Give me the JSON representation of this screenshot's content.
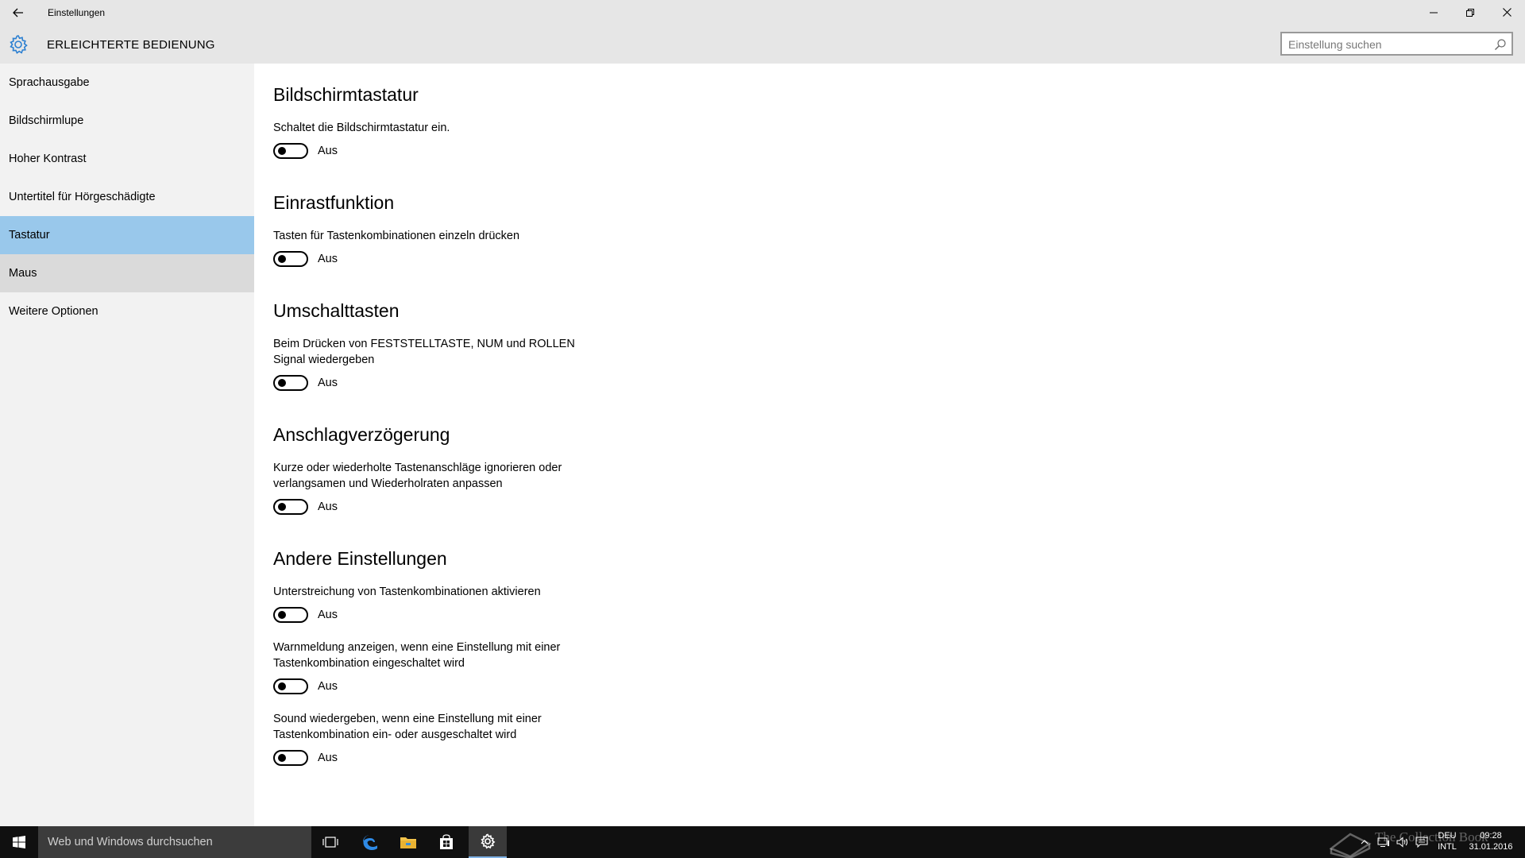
{
  "window": {
    "title": "Einstellungen",
    "header_title": "ERLEICHTERTE BEDIENUNG",
    "search_placeholder": "Einstellung suchen"
  },
  "sidebar": {
    "items": [
      {
        "label": "Sprachausgabe"
      },
      {
        "label": "Bildschirmlupe"
      },
      {
        "label": "Hoher Kontrast"
      },
      {
        "label": "Untertitel für Hörgeschädigte"
      },
      {
        "label": "Tastatur",
        "state": "selected"
      },
      {
        "label": "Maus",
        "state": "hover"
      },
      {
        "label": "Weitere Optionen"
      }
    ]
  },
  "sections": {
    "bildschirmtastatur": {
      "title": "Bildschirmtastatur",
      "items": [
        {
          "desc": "Schaltet die Bildschirmtastatur ein.",
          "state": "Aus"
        }
      ]
    },
    "einrastfunktion": {
      "title": "Einrastfunktion",
      "items": [
        {
          "desc": "Tasten für Tastenkombinationen einzeln drücken",
          "state": "Aus"
        }
      ]
    },
    "umschalttasten": {
      "title": "Umschalttasten",
      "items": [
        {
          "desc": "Beim Drücken von FESTSTELLTASTE, NUM und ROLLEN Signal wiedergeben",
          "state": "Aus"
        }
      ]
    },
    "anschlagverzoegerung": {
      "title": "Anschlagverzögerung",
      "items": [
        {
          "desc": "Kurze oder wiederholte Tastenanschläge ignorieren oder verlangsamen und Wiederholraten anpassen",
          "state": "Aus"
        }
      ]
    },
    "andere": {
      "title": "Andere Einstellungen",
      "items": [
        {
          "desc": "Unterstreichung von Tastenkombinationen aktivieren",
          "state": "Aus"
        },
        {
          "desc": "Warnmeldung anzeigen, wenn eine Einstellung mit einer Tastenkombination eingeschaltet wird",
          "state": "Aus"
        },
        {
          "desc": "Sound wiedergeben, wenn eine Einstellung mit einer Tastenkombination ein- oder ausgeschaltet wird",
          "state": "Aus"
        }
      ]
    }
  },
  "taskbar": {
    "search_placeholder": "Web und Windows durchsuchen",
    "language_top": "DEU",
    "language_bottom": "INTL",
    "time": "09:28",
    "date": "31.01.2016",
    "watermark": "The Collection Book"
  },
  "colors": {
    "selected_nav": "#99c8eb",
    "hover_nav": "#dadada",
    "accent_icon": "#2b7fd1",
    "taskbar": "#101010"
  },
  "icons": {
    "back": "arrow-left-icon",
    "logo": "gear-icon",
    "search": "magnifier-icon",
    "start": "windows-logo-icon",
    "task_view": "task-view-icon",
    "edge": "edge-browser-icon",
    "explorer": "folder-icon",
    "store": "store-bag-icon",
    "settings": "gear-icon"
  }
}
